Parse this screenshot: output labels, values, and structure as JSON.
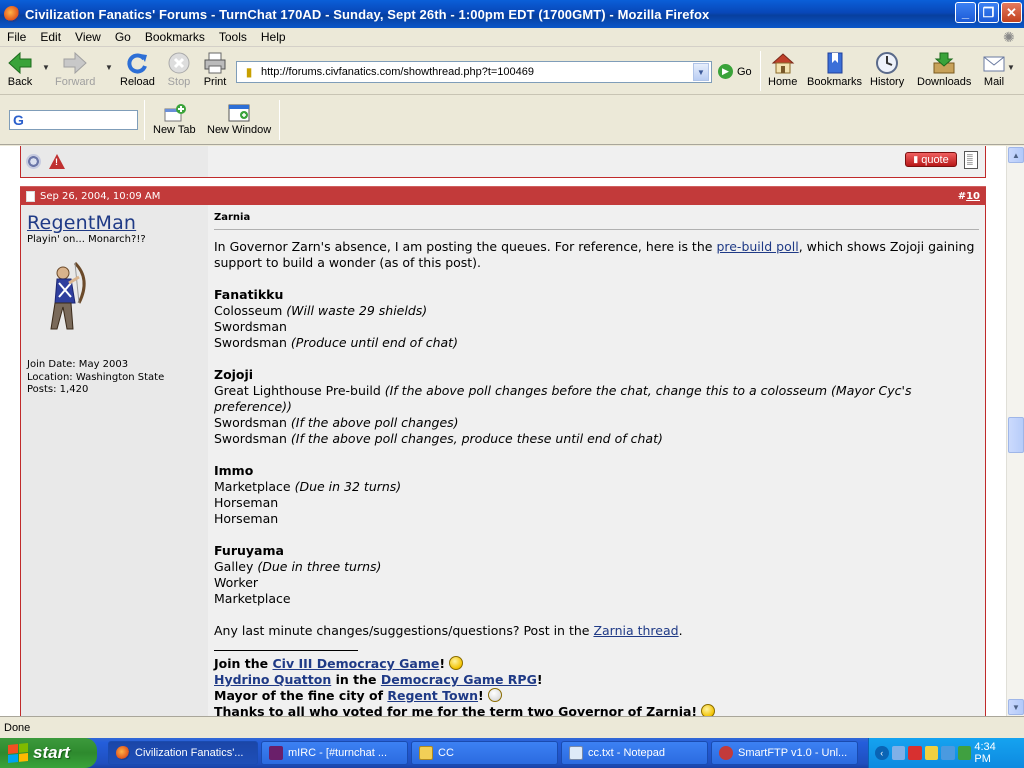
{
  "window": {
    "title": "Civilization Fanatics' Forums - TurnChat 170AD - Sunday, Sept 26th - 1:00pm EDT (1700GMT) - Mozilla Firefox",
    "min": "_",
    "max": "❐",
    "close": "✕"
  },
  "menu": [
    "File",
    "Edit",
    "View",
    "Go",
    "Bookmarks",
    "Tools",
    "Help"
  ],
  "toolbar": {
    "back": "Back",
    "forward": "Forward",
    "reload": "Reload",
    "stop": "Stop",
    "print": "Print",
    "url": "http://forums.civfanatics.com/showthread.php?t=100469",
    "go": "Go",
    "home": "Home",
    "bookmarks": "Bookmarks",
    "history": "History",
    "downloads": "Downloads",
    "mail": "Mail"
  },
  "toolbar2": {
    "new_tab": "New Tab",
    "new_window": "New Window"
  },
  "prev_post": {
    "quote_label": "quote"
  },
  "post": {
    "date": "Sep 26, 2004, 10:09 AM",
    "number_prefix": "#",
    "number": "10",
    "user": {
      "name": "RegentMan",
      "title": "Playin' on... Monarch?!?",
      "join_date": "Join Date: May 2003",
      "location": "Location: Washington State",
      "posts": "Posts: 1,420"
    },
    "title": "Zarnia",
    "intro_1": "In Governor Zarn's absence, I am posting the queues. For reference, here is the ",
    "intro_link": "pre-build poll",
    "intro_2": ", which shows Zojoji gaining support to build a wonder (as of this post).",
    "cities": [
      {
        "name": "Fanatikku",
        "lines": [
          {
            "text": "Colosseum ",
            "note": "(Will waste 29 shields)"
          },
          {
            "text": "Swordsman",
            "note": ""
          },
          {
            "text": "Swordsman ",
            "note": "(Produce until end of chat)"
          }
        ]
      },
      {
        "name": "Zojoji",
        "lines": [
          {
            "text": "Great Lighthouse Pre-build ",
            "note": "(If the above poll changes before the chat, change this to a colosseum (Mayor Cyc's preference))"
          },
          {
            "text": "Swordsman ",
            "note": "(If the above poll changes)"
          },
          {
            "text": "Swordsman ",
            "note": "(If the above poll changes, produce these until end of chat)"
          }
        ]
      },
      {
        "name": "Immo",
        "lines": [
          {
            "text": "Marketplace ",
            "note": "(Due in 32 turns)"
          },
          {
            "text": "Horseman",
            "note": ""
          },
          {
            "text": "Horseman",
            "note": ""
          }
        ]
      },
      {
        "name": "Furuyama",
        "lines": [
          {
            "text": "Galley ",
            "note": "(Due in three turns)"
          },
          {
            "text": "Worker",
            "note": ""
          },
          {
            "text": "Marketplace",
            "note": ""
          }
        ]
      }
    ],
    "outro_1": "Any last minute changes/suggestions/questions? Post in the ",
    "outro_link": "Zarnia thread",
    "outro_2": ".",
    "signature": {
      "l1_a": "Join the ",
      "l1_link": "Civ III Democracy Game",
      "l1_b": "! ",
      "l2_link": "Hydrino Quatton",
      "l2_a": " in the ",
      "l2_link2": "Democracy Game RPG",
      "l2_b": "!",
      "l3_a": "Mayor of the fine city of ",
      "l3_link": "Regent Town",
      "l3_b": "! ",
      "l4": "Thanks to all who voted for me for the term two Governor of Zarnia! "
    }
  },
  "status": "Done",
  "taskbar": {
    "start": "start",
    "tasks": [
      "Civilization Fanatics'...",
      "mIRC - [#turnchat ...",
      "CC",
      "cc.txt - Notepad",
      "SmartFTP v1.0 - Unl..."
    ],
    "clock": "4:34 PM"
  },
  "colors": {
    "post_header": "#c23a3a",
    "link": "#1f3a86",
    "panel": "#e9e9e9",
    "content": "#f0f0f0"
  }
}
